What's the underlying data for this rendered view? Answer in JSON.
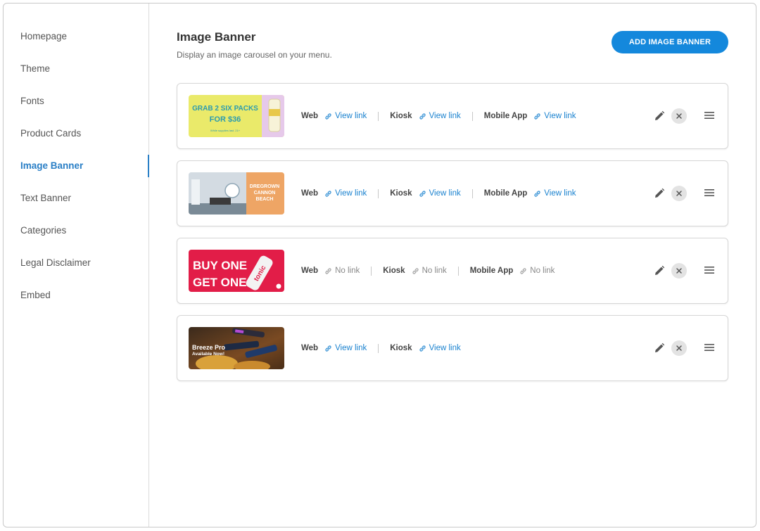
{
  "sidebar": {
    "items": [
      {
        "label": "Homepage",
        "active": false
      },
      {
        "label": "Theme",
        "active": false
      },
      {
        "label": "Fonts",
        "active": false
      },
      {
        "label": "Product Cards",
        "active": false
      },
      {
        "label": "Image Banner",
        "active": true
      },
      {
        "label": "Text Banner",
        "active": false
      },
      {
        "label": "Categories",
        "active": false
      },
      {
        "label": "Legal Disclaimer",
        "active": false
      },
      {
        "label": "Embed",
        "active": false
      }
    ]
  },
  "header": {
    "title": "Image Banner",
    "subtitle": "Display an image carousel on your menu.",
    "add_button_label": "ADD IMAGE BANNER"
  },
  "colors": {
    "accent": "#1488dc",
    "active_nav": "#2a7fc6",
    "link": "#1a82cf",
    "no_link": "#888888"
  },
  "icons": {
    "link": "link-icon",
    "edit": "pencil-icon",
    "remove": "close-icon",
    "drag": "drag-handle-icon"
  },
  "banners": [
    {
      "image_text": [
        "GRAB 2 SIX PACKS",
        "FOR $36",
        "While supplies last. 21+"
      ],
      "links": [
        {
          "label": "Web",
          "value": "View link",
          "has_link": true
        },
        {
          "label": "Kiosk",
          "value": "View link",
          "has_link": true
        },
        {
          "label": "Mobile App",
          "value": "View link",
          "has_link": true
        }
      ]
    },
    {
      "image_text": [
        "DREGROWN",
        "CANNON",
        "BEACH"
      ],
      "links": [
        {
          "label": "Web",
          "value": "View link",
          "has_link": true
        },
        {
          "label": "Kiosk",
          "value": "View link",
          "has_link": true
        },
        {
          "label": "Mobile App",
          "value": "View link",
          "has_link": true
        }
      ]
    },
    {
      "image_text": [
        "BUY ONE",
        "GET ONE",
        "tonic"
      ],
      "links": [
        {
          "label": "Web",
          "value": "No link",
          "has_link": false
        },
        {
          "label": "Kiosk",
          "value": "No link",
          "has_link": false
        },
        {
          "label": "Mobile App",
          "value": "No link",
          "has_link": false
        }
      ]
    },
    {
      "image_text": [
        "Breeze Pro",
        "Available Now!"
      ],
      "links": [
        {
          "label": "Web",
          "value": "View link",
          "has_link": true
        },
        {
          "label": "Kiosk",
          "value": "View link",
          "has_link": true
        }
      ]
    }
  ]
}
